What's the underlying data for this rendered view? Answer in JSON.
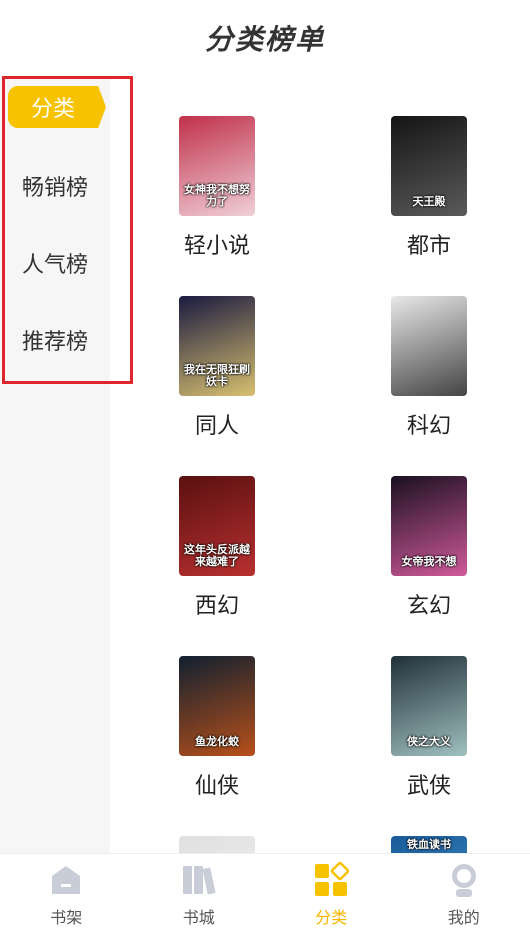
{
  "header": {
    "title": "分类榜单"
  },
  "sidebar": {
    "items": [
      {
        "label": "分类",
        "active": true
      },
      {
        "label": "畅销榜",
        "active": false
      },
      {
        "label": "人气榜",
        "active": false
      },
      {
        "label": "推荐榜",
        "active": false
      }
    ]
  },
  "categories": [
    {
      "label": "轻小说",
      "cover_text": "女神我不想努力了",
      "colors": [
        "#c0304a",
        "#f0d0d8"
      ]
    },
    {
      "label": "都市",
      "cover_text": "天王殿",
      "colors": [
        "#151515",
        "#5a5a5a"
      ]
    },
    {
      "label": "同人",
      "cover_text": "我在无限狂刷妖卡",
      "colors": [
        "#1a1a40",
        "#d8c070"
      ]
    },
    {
      "label": "科幻",
      "cover_text": "",
      "colors": [
        "#e8e8e8",
        "#444444"
      ]
    },
    {
      "label": "西幻",
      "cover_text": "这年头反派越来越难了",
      "colors": [
        "#5a1010",
        "#b83030"
      ]
    },
    {
      "label": "玄幻",
      "cover_text": "女帝我不想",
      "colors": [
        "#1a1020",
        "#d05a9a"
      ]
    },
    {
      "label": "仙侠",
      "cover_text": "鱼龙化蛟",
      "colors": [
        "#102030",
        "#b8501a"
      ]
    },
    {
      "label": "武侠",
      "cover_text": "侠之大义",
      "colors": [
        "#20303a",
        "#a0c0c0"
      ]
    },
    {
      "label": "",
      "cover_text": "",
      "colors": [
        "#e0e0e0",
        "#f4f4f4"
      ]
    },
    {
      "label": "",
      "cover_text": "铁血读书",
      "colors": [
        "#1a5a9a",
        "#4aa0d0"
      ]
    }
  ],
  "tabbar": {
    "tabs": [
      {
        "label": "书架",
        "icon": "bookshelf-icon",
        "active": false
      },
      {
        "label": "书城",
        "icon": "bookstore-icon",
        "active": false
      },
      {
        "label": "分类",
        "icon": "category-icon",
        "active": true
      },
      {
        "label": "我的",
        "icon": "profile-icon",
        "active": false
      }
    ]
  },
  "colors": {
    "accent": "#f7c200",
    "highlight_border": "#e0262d"
  }
}
